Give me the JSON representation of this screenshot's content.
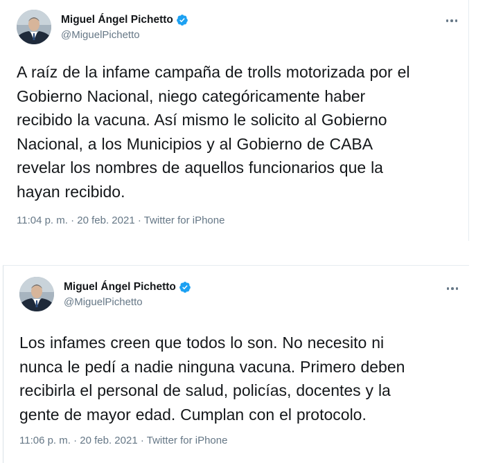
{
  "tweets": [
    {
      "display_name": "Miguel Ángel Pichetto",
      "handle": "@MiguelPichetto",
      "verified": true,
      "text_lines": [
        "A raíz de la infame campaña de trolls motorizada por el",
        "Gobierno Nacional, niego categóricamente haber",
        "recibido la vacuna. Así mismo le solicito al Gobierno",
        "Nacional, a los Municipios y al Gobierno de CABA",
        "revelar los nombres de aquellos funcionarios que la",
        "hayan recibido."
      ],
      "meta": "11:04 p. m. · 20 feb. 2021 · Twitter for iPhone"
    },
    {
      "display_name": "Miguel Ángel Pichetto",
      "handle": "@MiguelPichetto",
      "verified": true,
      "text_lines": [
        "Los infames creen que todos lo son. No necesito ni",
        "nunca le pedí a nadie ninguna vacuna. Primero deben",
        "recibirla el personal de salud, policías, docentes y la",
        "gente de mayor edad. Cumplan con el protocolo."
      ],
      "meta": "11:06 p. m. · 20 feb. 2021 · Twitter for iPhone"
    }
  ],
  "icons": {
    "verified": "verified-badge-icon",
    "more": "more-options-icon",
    "avatar": "profile-avatar"
  },
  "colors": {
    "name": "#14171a",
    "secondary": "#657786",
    "verified": "#1da1f2",
    "border": "#e6ecf0"
  }
}
